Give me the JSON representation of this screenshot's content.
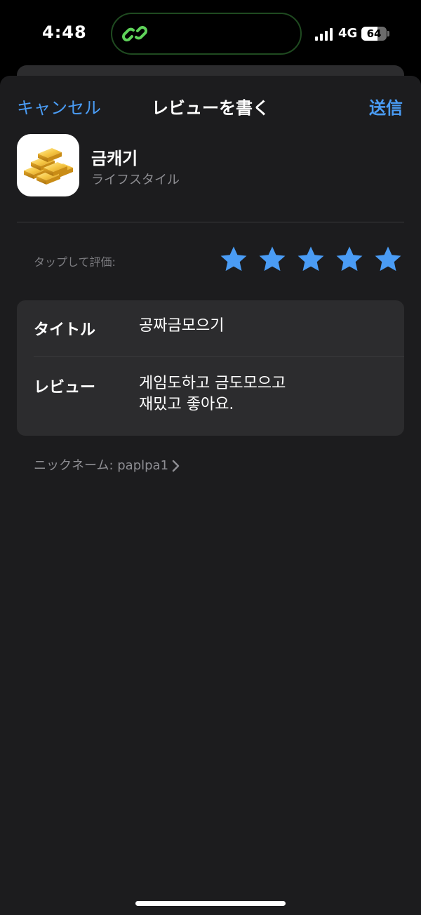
{
  "status_bar": {
    "time": "4:48",
    "network": "4G",
    "battery_percent": "64",
    "battery_level": 0.64,
    "island_icon": "link-chain-icon",
    "island_icon_color": "#5fd35a"
  },
  "nav": {
    "cancel_label": "キャンセル",
    "title": "レビューを書く",
    "send_label": "送信",
    "accent_color": "#4a9cf5"
  },
  "app": {
    "name": "금캐기",
    "category": "ライフスタイル",
    "icon": "gold-bars-icon"
  },
  "rating": {
    "prompt": "タップして評価:",
    "stars": 5,
    "max_stars": 5,
    "star_color": "#4a9cf5"
  },
  "form": {
    "title_label": "タイトル",
    "title_value": "공짜금모으기",
    "review_label": "レビュー",
    "review_line1": "게임도하고 금도모으고",
    "review_line2": "재밌고 좋아요."
  },
  "nickname": {
    "text": "ニックネーム: paplpa1"
  }
}
